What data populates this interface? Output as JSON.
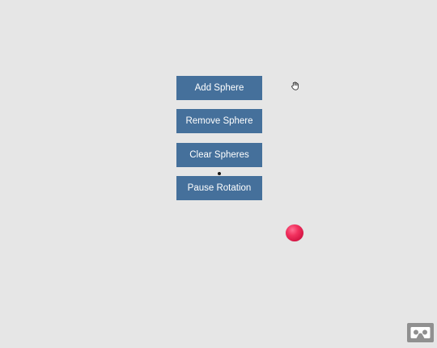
{
  "scene": {
    "background_color": "#e6e6e6"
  },
  "menu": {
    "button_color": "#45709b",
    "button_text_color": "#ffffff",
    "buttons": [
      {
        "id": "add",
        "label": "Add Sphere"
      },
      {
        "id": "remove",
        "label": "Remove Sphere"
      },
      {
        "id": "clear",
        "label": "Clear Spheres"
      },
      {
        "id": "pause",
        "label": "Pause Rotation"
      }
    ]
  },
  "sphere": {
    "color": "#e8204f"
  },
  "icons": {
    "cursor": "hand-pointer-icon",
    "vr": "cardboard-vr-icon"
  }
}
